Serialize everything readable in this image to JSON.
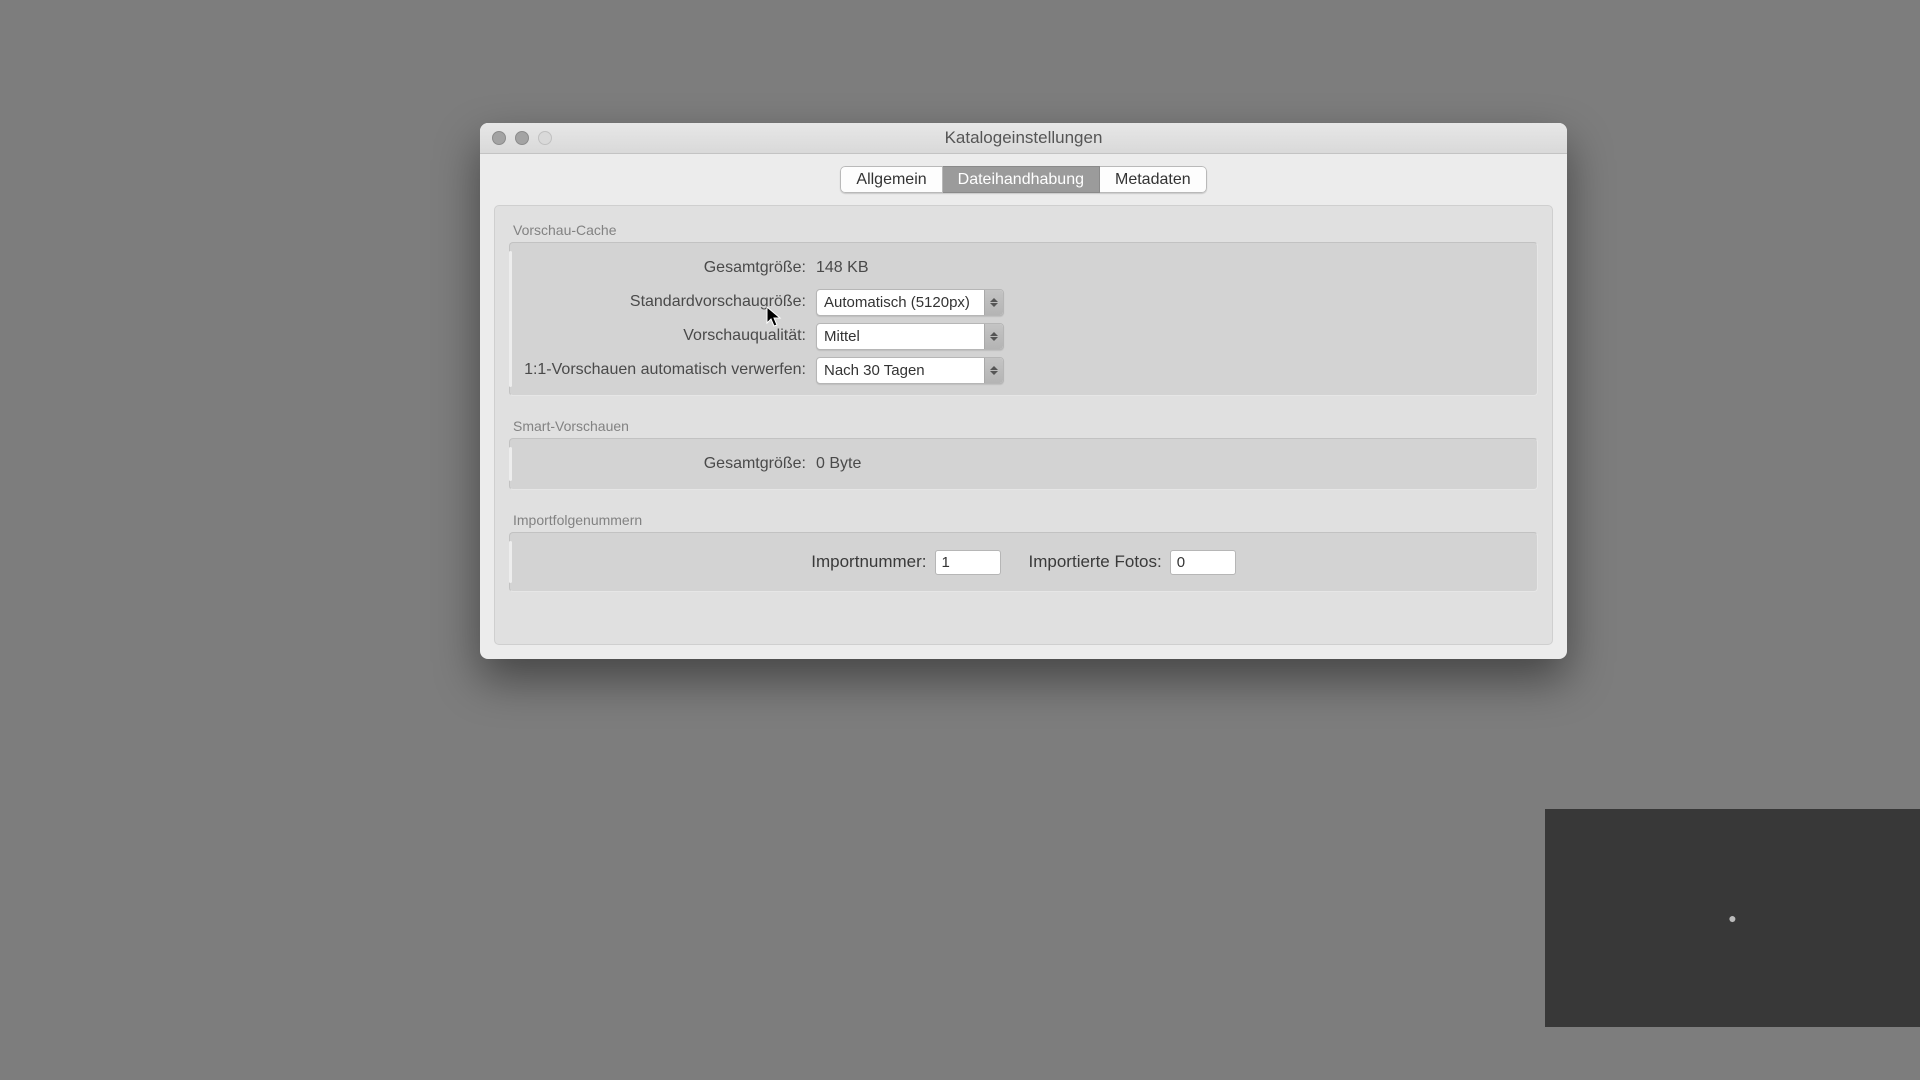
{
  "window": {
    "title": "Katalogeinstellungen"
  },
  "tabs": {
    "general": "Allgemein",
    "filehandling": "Dateihandhabung",
    "metadata": "Metadaten"
  },
  "preview_cache": {
    "legend": "Vorschau-Cache",
    "total_size_label": "Gesamtgröße:",
    "total_size_value": "148 KB",
    "std_size_label": "Standardvorschaugröße:",
    "std_size_value": "Automatisch (5120px)",
    "quality_label": "Vorschauqualität:",
    "quality_value": "Mittel",
    "discard_label": "1:1-Vorschauen automatisch verwerfen:",
    "discard_value": "Nach 30 Tagen"
  },
  "smart_previews": {
    "legend": "Smart-Vorschauen",
    "total_size_label": "Gesamtgröße:",
    "total_size_value": "0 Byte"
  },
  "import_seq": {
    "legend": "Importfolgenummern",
    "number_label": "Importnummer:",
    "number_value": "1",
    "photos_label": "Importierte Fotos:",
    "photos_value": "0"
  }
}
